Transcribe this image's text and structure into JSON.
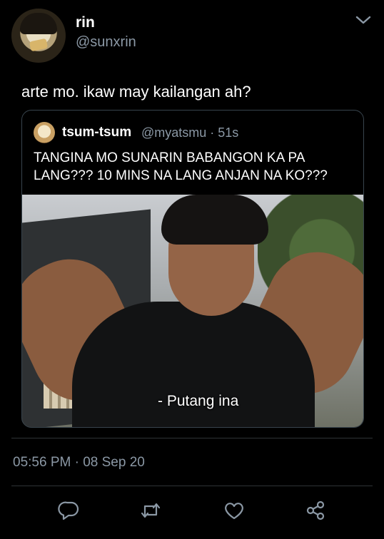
{
  "tweet": {
    "name": "rin",
    "handle": "@sunxrin",
    "text": "arte mo. ikaw may kailangan ah?",
    "timestamp": "05:56 PM · 08 Sep 20"
  },
  "quoted_tweet": {
    "name": "tsum-tsum",
    "handle_time": "@myatsmu · 51s",
    "text": "TANGINA MO SUNARIN BABANGON KA PA LANG??? 10 MINS NA LANG ANJAN NA KO???",
    "media_caption": "- Putang ina"
  },
  "icons": {
    "more": "chevron-down-icon",
    "reply": "reply-icon",
    "retweet": "retweet-icon",
    "like": "like-icon",
    "share": "share-icon"
  },
  "colors": {
    "background": "#000000",
    "primary_text": "#ffffff",
    "secondary_text": "#8b98a5",
    "border": "#38444d"
  }
}
